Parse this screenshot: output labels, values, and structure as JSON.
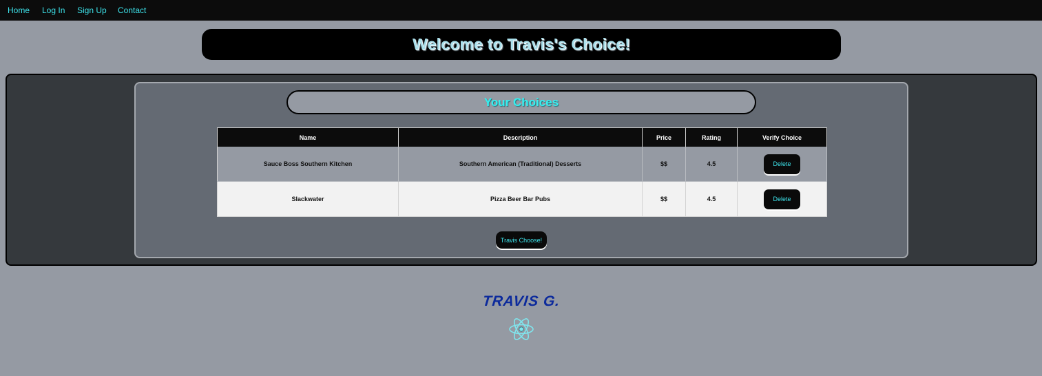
{
  "nav": {
    "home": "Home",
    "login": "Log In",
    "signup": "Sign Up",
    "contact": "Contact"
  },
  "hero": {
    "title": "Welcome to Travis's Choice!"
  },
  "choices": {
    "title": "Your Choices",
    "columns": [
      "Name",
      "Description",
      "Price",
      "Rating",
      "Verify Choice"
    ],
    "rows": [
      {
        "name": "Sauce Boss Southern Kitchen",
        "description": "Southern American (Traditional) Desserts",
        "price": "$$",
        "rating": "4.5",
        "action": "Delete"
      },
      {
        "name": "Slackwater",
        "description": "Pizza Beer Bar Pubs",
        "price": "$$",
        "rating": "4.5",
        "action": "Delete"
      }
    ],
    "choose_button": "Travis Choose!"
  },
  "footer": {
    "logo_text": "TRAVIS G.",
    "icon": "atom-icon",
    "logo_color": "#0c2a9c",
    "icon_color": "#7fe6ee"
  },
  "colors": {
    "accent": "#3ee6ee",
    "background": "#959aa3",
    "panel_dark": "#35393d",
    "panel_mid": "#646a73"
  }
}
